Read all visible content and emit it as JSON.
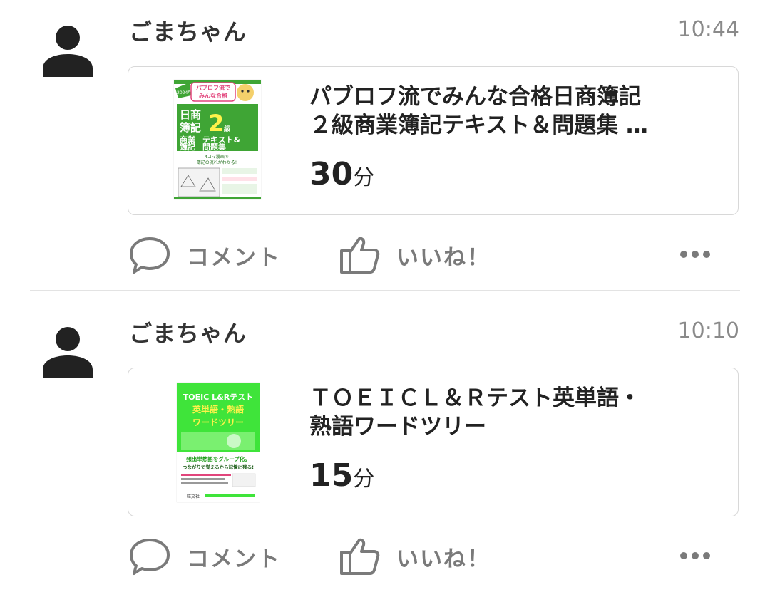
{
  "posts": [
    {
      "user": "ごまちゃん",
      "time": "10:44",
      "book": {
        "title_line1": "パブロフ流でみんな合格日商簿記",
        "title_line2": "２級商業簿記テキスト＆問題集 …",
        "duration": "30",
        "unit": "分",
        "cover": {
          "top_label": "パブロフ流で みんな合格",
          "year": "2024年度版",
          "big_title_a": "日商",
          "big_title_b": "簿記",
          "grade": "2",
          "grade_unit": "級",
          "subject_a": "商業",
          "subject_b": "簿記",
          "sub_title": "テキスト&問題集",
          "catch": "4コマ漫画で 簿記の流れがわかる!",
          "colors": {
            "bg": "#ffffff",
            "accent": "#3fa535",
            "dark": "#1f6e1a",
            "pink": "#e2457c"
          }
        }
      },
      "actions": {
        "comment": "コメント",
        "like": "いいね！"
      }
    },
    {
      "user": "ごまちゃん",
      "time": "10:10",
      "book": {
        "title_line1": "ＴＯＥＩＣＬ＆Ｒテスト英単語・",
        "title_line2": "熟語ワードツリー",
        "duration": "15",
        "unit": "分",
        "cover": {
          "line1": "TOEIC L&Rテスト",
          "line2": "英単語・熟語",
          "line3": "ワードツリー",
          "catch1": "頻出単熟語をグループ化。",
          "catch2": "つながりで覚えるから記憶に残る!",
          "publisher": "旺文社",
          "colors": {
            "bg": "#3fe43a",
            "white": "#ffffff",
            "yellow": "#fff24a",
            "text": "#1a5c16"
          }
        }
      },
      "actions": {
        "comment": "コメント",
        "like": "いいね！"
      }
    }
  ],
  "icons": {
    "avatar": "person-silhouette-icon",
    "comment": "speech-bubble-icon",
    "like": "thumbs-up-icon",
    "more": "more-horizontal-icon"
  },
  "colors": {
    "text": "#222222",
    "muted": "#8a8a8a",
    "action": "#7a7a7a",
    "border": "#d8d8d8",
    "divider": "#e3e3e3"
  }
}
